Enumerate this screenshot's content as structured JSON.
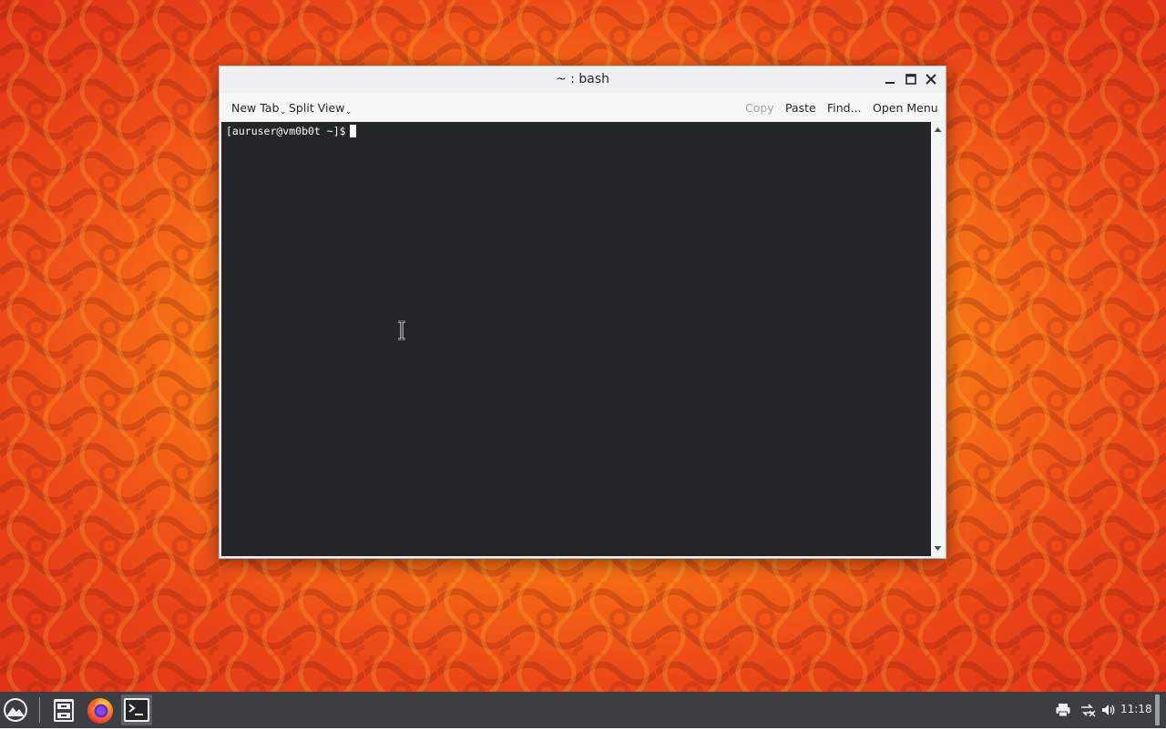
{
  "window": {
    "title": "~ : bash"
  },
  "toolbar": {
    "new_tab_label": "New Tab",
    "split_view_label": "Split View",
    "copy_label": "Copy",
    "paste_label": "Paste",
    "find_label": "Find...",
    "open_menu_label": "Open Menu"
  },
  "terminal": {
    "prompt": "[auruser@vm0b0t ~]$"
  },
  "taskbar": {
    "apps": [
      {
        "name": "application-launcher",
        "icon": "launcher-icon"
      },
      {
        "name": "file-manager",
        "icon": "folder-icon"
      },
      {
        "name": "firefox",
        "icon": "firefox-icon"
      },
      {
        "name": "terminal",
        "icon": "terminal-icon",
        "active": true
      }
    ],
    "clock": "11:18"
  },
  "colors": {
    "terminal_bg": "#232627",
    "terminal_fg": "#fcfcfc",
    "taskbar_bg": "#3b3f43",
    "window_bg": "#eff0f1",
    "disabled_text": "#a0a3a6"
  }
}
